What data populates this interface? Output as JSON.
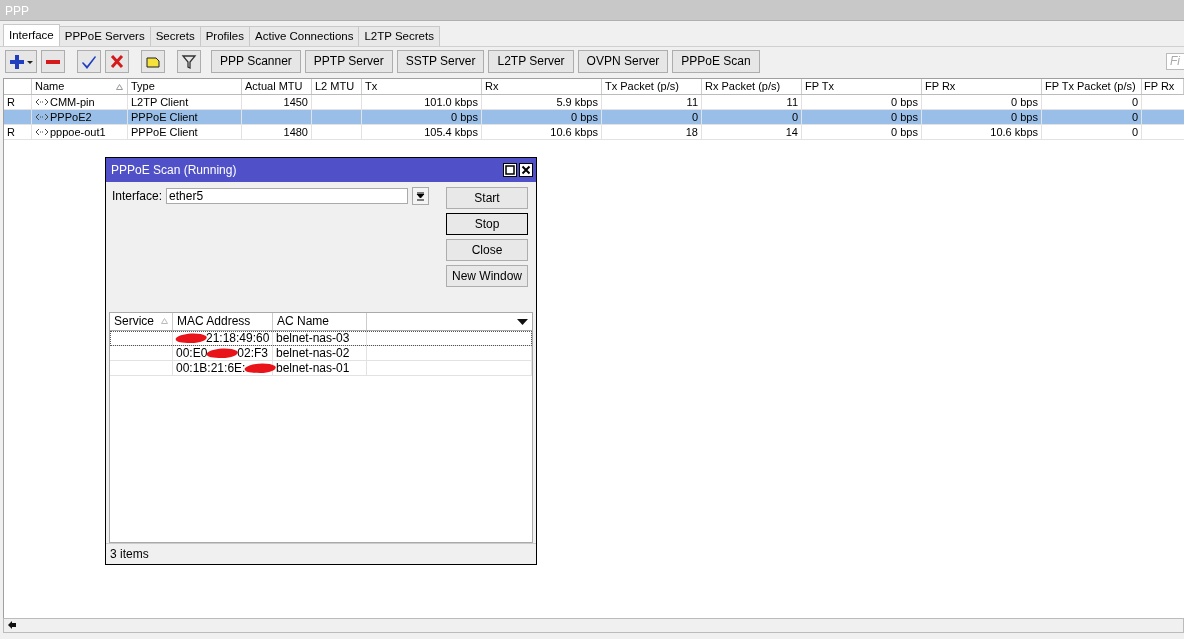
{
  "window": {
    "title": "PPP"
  },
  "tabs": [
    {
      "label": "Interface",
      "selected": true
    },
    {
      "label": "PPPoE Servers",
      "selected": false
    },
    {
      "label": "Secrets",
      "selected": false
    },
    {
      "label": "Profiles",
      "selected": false
    },
    {
      "label": "Active Connections",
      "selected": false
    },
    {
      "label": "L2TP Secrets",
      "selected": false
    }
  ],
  "toolbar": {
    "buttons": [
      "PPP Scanner",
      "PPTP Server",
      "SSTP Server",
      "L2TP Server",
      "OVPN Server",
      "PPPoE Scan"
    ],
    "find": {
      "placeholder": "Fi"
    }
  },
  "table": {
    "columns": [
      "",
      "Name",
      "Type",
      "Actual MTU",
      "L2 MTU",
      "Tx",
      "Rx",
      "Tx Packet (p/s)",
      "Rx Packet (p/s)",
      "FP Tx",
      "FP Rx",
      "FP Tx Packet (p/s)",
      "FP Rx"
    ],
    "rows": [
      {
        "selected": false,
        "cells": [
          "R",
          "CMM-pin",
          "L2TP Client",
          "1450",
          "",
          "101.0 kbps",
          "5.9 kbps",
          "11",
          "11",
          "0 bps",
          "0 bps",
          "0",
          ""
        ]
      },
      {
        "selected": true,
        "cells": [
          "",
          "PPPoE2",
          "PPPoE Client",
          "",
          "",
          "0 bps",
          "0 bps",
          "0",
          "0",
          "0 bps",
          "0 bps",
          "0",
          ""
        ]
      },
      {
        "selected": false,
        "cells": [
          "R",
          "pppoe-out1",
          "PPPoE Client",
          "1480",
          "",
          "105.4 kbps",
          "10.6 kbps",
          "18",
          "14",
          "0 bps",
          "10.6 kbps",
          "0",
          ""
        ]
      }
    ]
  },
  "dialog": {
    "title": "PPPoE Scan (Running)",
    "interface_label": "Interface:",
    "interface_value": "ether5",
    "buttons": [
      {
        "label": "Start",
        "focused": false
      },
      {
        "label": "Stop",
        "focused": true
      },
      {
        "label": "Close",
        "focused": false
      },
      {
        "label": "New Window",
        "focused": false
      }
    ],
    "columns": [
      "Service",
      "MAC Address",
      "AC Name"
    ],
    "rows": [
      {
        "focused": true,
        "service": "",
        "mac_before": "",
        "mac_after": "21:18:49:60",
        "ac_name": "belnet-nas-03"
      },
      {
        "focused": false,
        "service": "",
        "mac_before": "00:E0",
        "mac_after": "02:F3",
        "ac_name": "belnet-nas-02"
      },
      {
        "focused": false,
        "service": "",
        "mac_before": "00:1B:21:6E:",
        "mac_after": "",
        "ac_name": "belnet-nas-01"
      }
    ],
    "status": "3 items"
  }
}
